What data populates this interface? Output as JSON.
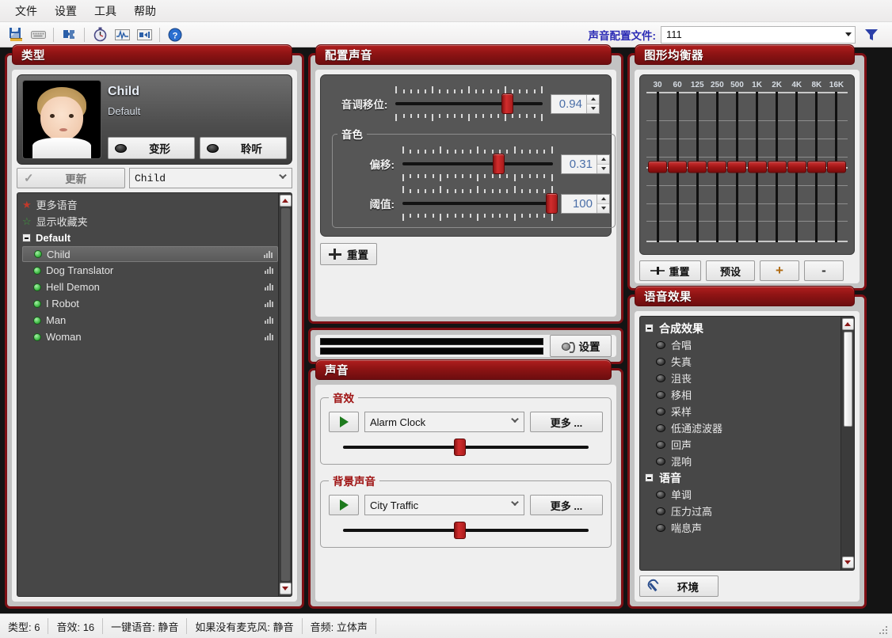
{
  "menu": {
    "items": [
      {
        "label": "文件"
      },
      {
        "label": "设置"
      },
      {
        "label": "工具"
      },
      {
        "label": "帮助"
      }
    ]
  },
  "toolbar": {
    "icons": [
      {
        "name": "save-settings-icon"
      },
      {
        "name": "keyboard-icon"
      },
      {
        "name": "plugin-icon"
      },
      {
        "name": "stopwatch-icon"
      },
      {
        "name": "waveform-icon"
      },
      {
        "name": "audio-transform-icon"
      },
      {
        "name": "help-icon"
      }
    ],
    "profile_label": "声音配置文件:",
    "profile_value": "111",
    "filter_icon": "funnel-icon"
  },
  "type_panel": {
    "title": "类型",
    "avatar": {
      "name": "Child",
      "subtitle": "Default"
    },
    "morph_button": "变形",
    "listen_button": "聆听",
    "update_button": "更新",
    "type_combo_value": "Child",
    "list": [
      {
        "label": "更多语音",
        "icon": "star-red-icon",
        "kind": "link"
      },
      {
        "label": "显示收藏夹",
        "icon": "star-green-icon",
        "kind": "link"
      },
      {
        "label": "Default",
        "kind": "group"
      },
      {
        "label": "Child",
        "kind": "voice",
        "selected": true
      },
      {
        "label": "Dog Translator",
        "kind": "voice",
        "selected": false
      },
      {
        "label": "Hell Demon",
        "kind": "voice",
        "selected": false
      },
      {
        "label": "I Robot",
        "kind": "voice",
        "selected": false
      },
      {
        "label": "Man",
        "kind": "voice",
        "selected": false
      },
      {
        "label": "Woman",
        "kind": "voice",
        "selected": false
      }
    ]
  },
  "config_panel": {
    "title": "配置声音",
    "pitch": {
      "label": "音调移位:",
      "value": "0.94",
      "percent": 72
    },
    "timbre_group": "音色",
    "offset": {
      "label": "偏移:",
      "value": "0.31",
      "percent": 60
    },
    "threshold": {
      "label": "阈值:",
      "value": "100",
      "percent": 97
    },
    "reset_button": "重置"
  },
  "levels_panel": {
    "settings_button": "设置"
  },
  "sound_panel": {
    "title": "声音",
    "sfx": {
      "legend": "音效",
      "value": "Alarm Clock",
      "more_button": "更多 ...",
      "volume_percent": 45
    },
    "background": {
      "legend": "背景声音",
      "value": "City Traffic",
      "more_button": "更多 ...",
      "volume_percent": 45
    }
  },
  "equalizer_panel": {
    "title": "图形均衡器",
    "bands": [
      "30",
      "60",
      "125",
      "250",
      "500",
      "1K",
      "2K",
      "4K",
      "8K",
      "16K"
    ],
    "band_values": [
      0,
      0,
      0,
      0,
      0,
      0,
      0,
      0,
      0,
      0
    ],
    "reset_button": "重置",
    "preset_button": "预设",
    "add_button": "+",
    "remove_button": "-"
  },
  "effects_panel": {
    "title": "语音效果",
    "list": [
      {
        "label": "合成效果",
        "kind": "group"
      },
      {
        "label": "合唱",
        "kind": "effect"
      },
      {
        "label": "失真",
        "kind": "effect"
      },
      {
        "label": "沮丧",
        "kind": "effect"
      },
      {
        "label": "移相",
        "kind": "effect"
      },
      {
        "label": "采样",
        "kind": "effect"
      },
      {
        "label": "低通滤波器",
        "kind": "effect"
      },
      {
        "label": "回声",
        "kind": "effect"
      },
      {
        "label": "混响",
        "kind": "effect"
      },
      {
        "label": "语音",
        "kind": "group"
      },
      {
        "label": "单调",
        "kind": "effect"
      },
      {
        "label": "压力过高",
        "kind": "effect"
      },
      {
        "label": "喘息声",
        "kind": "effect"
      }
    ],
    "environment_button": "环境"
  },
  "statusbar": {
    "cells": [
      "类型: 6",
      "音效: 16",
      "一键语音: 静音",
      "如果没有麦克风: 静音",
      "音频: 立体声"
    ]
  }
}
